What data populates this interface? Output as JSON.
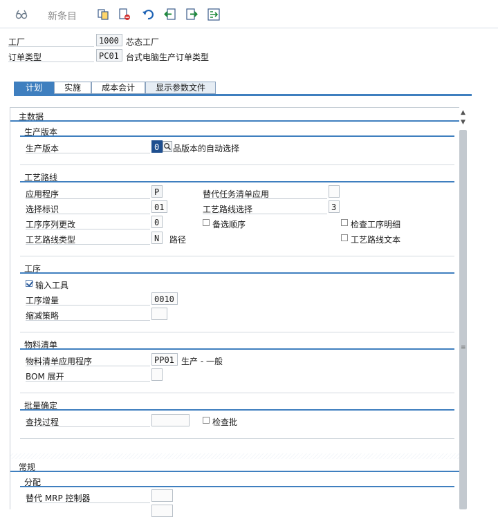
{
  "toolbar": {
    "new_entries_label": "新条目",
    "icons": [
      "glasses-icon",
      "copy-icon",
      "delete-icon",
      "undo-icon",
      "previous-entry-icon",
      "next-entry-icon",
      "select-block-icon"
    ]
  },
  "header": {
    "plant_label": "工厂",
    "plant_value": "1000",
    "plant_desc": "芯态工厂",
    "order_type_label": "订单类型",
    "order_type_value": "PC01",
    "order_type_desc": "台式电脑生产订单类型"
  },
  "tabs": [
    {
      "label": "计划",
      "active": true
    },
    {
      "label": "实施",
      "active": false
    },
    {
      "label": "成本会计",
      "active": false
    },
    {
      "label": "显示参数文件",
      "active": false
    }
  ],
  "master_data": {
    "title": "主数据",
    "production_version": {
      "title": "生产版本",
      "field_label": "生产版本",
      "field_value": "0",
      "field_desc": "品版本的自动选择"
    },
    "routing": {
      "title": "工艺路线",
      "application_label": "应用程序",
      "application_value": "P",
      "alt_task_list_label": "替代任务清单应用",
      "alt_task_list_value": "",
      "selection_id_label": "选择标识",
      "selection_id_value": "01",
      "routing_selection_label": "工艺路线选择",
      "routing_selection_value": "3",
      "op_seq_change_label": "工序序列更改",
      "op_seq_change_value": "0",
      "alt_sequence_label": "备选顺序",
      "check_op_details_label": "检查工序明细",
      "routing_type_label": "工艺路线类型",
      "routing_type_value": "N",
      "routing_type_desc": "路径",
      "routing_text_label": "工艺路线文本"
    },
    "operation": {
      "title": "工序",
      "enter_tools_label": "输入工具",
      "increment_label": "工序增量",
      "increment_value": "0010",
      "reduction_label": "缩减策略",
      "reduction_value": ""
    },
    "bom": {
      "title": "物料清单",
      "application_label": "物料清单应用程序",
      "application_value": "PP01",
      "application_desc": "生产 - 一般",
      "explosion_label": "BOM 展开",
      "explosion_value": ""
    },
    "batch": {
      "title": "批量确定",
      "search_label": "查找过程",
      "search_value": "",
      "check_batch_label": "检查批"
    }
  },
  "general": {
    "title": "常规",
    "assignment": {
      "title": "分配",
      "alt_mrp_label": "替代 MRP 控制器",
      "alt_mrp_value": ""
    }
  }
}
